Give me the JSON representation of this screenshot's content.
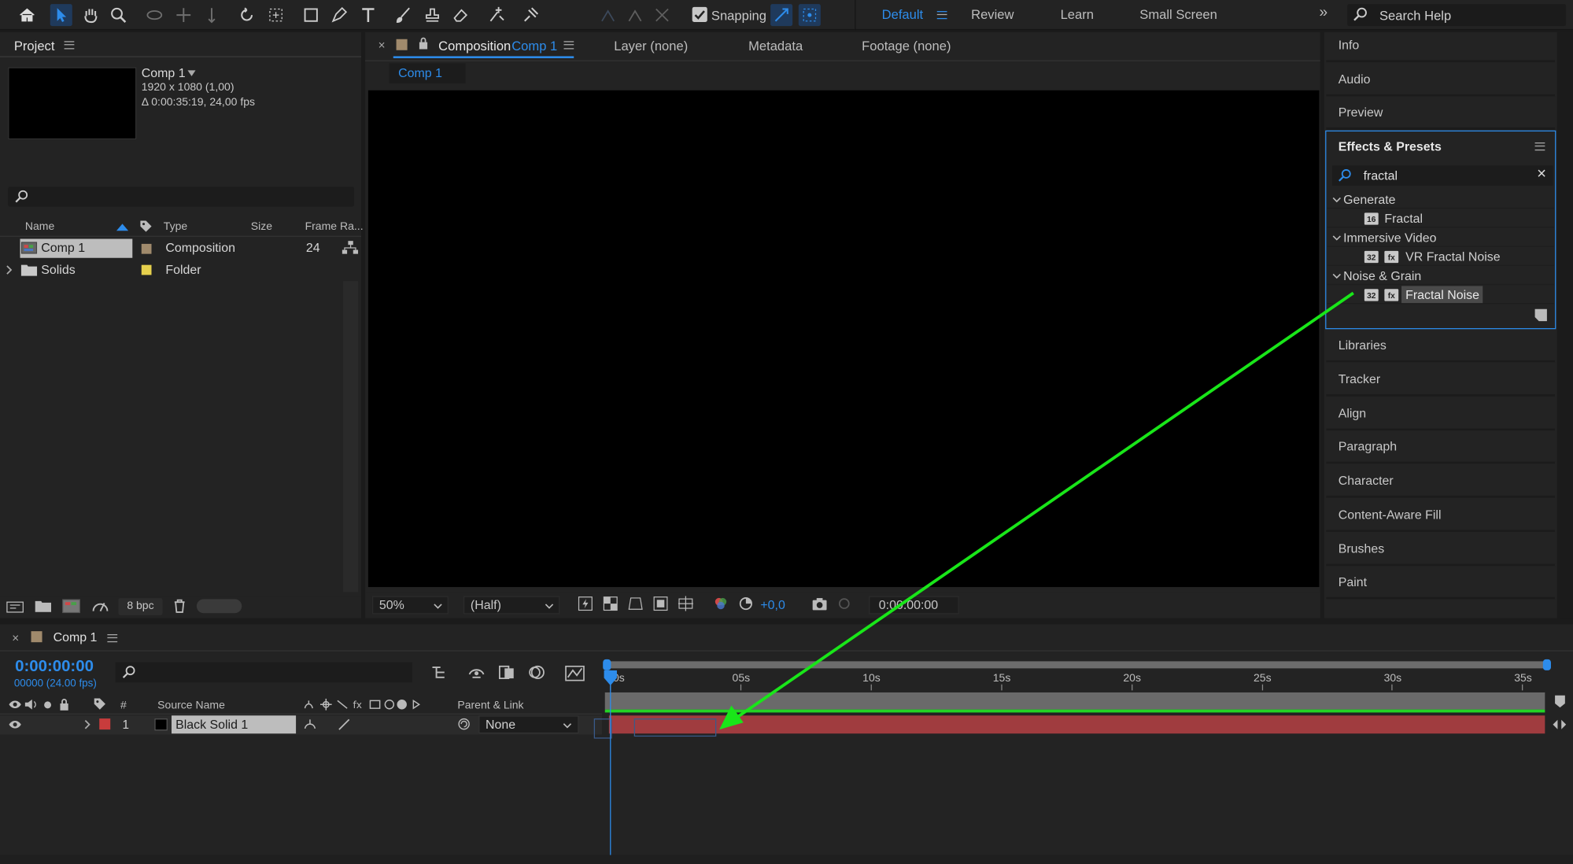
{
  "toolbar": {
    "snapping_label": "Snapping",
    "workspaces": [
      "Default",
      "Review",
      "Learn",
      "Small Screen"
    ],
    "overflow": "»",
    "search_placeholder": "Search Help"
  },
  "project": {
    "panel_title": "Project",
    "comp_name": "Comp 1",
    "comp_res": "1920 x 1080 (1,00)",
    "comp_duration": "Δ 0:00:35:19, 24,00 fps",
    "columns": {
      "name": "Name",
      "type": "Type",
      "size": "Size",
      "framerate": "Frame Ra..."
    },
    "rows": [
      {
        "name": "Comp 1",
        "type": "Composition",
        "framerate": "24",
        "label_color": "#a08a6c"
      },
      {
        "name": "Solids",
        "type": "Folder",
        "framerate": "",
        "label_color": "#e6d04d"
      }
    ],
    "bpc": "8 bpc"
  },
  "viewer": {
    "comp_tab_prefix": "Composition",
    "comp_tab_name": "Comp 1",
    "tabs": [
      "Layer (none)",
      "Metadata",
      "Footage (none)"
    ],
    "breadcrumb": "Comp 1",
    "zoom": "50%",
    "resolution": "(Half)",
    "exposure": "+0,0",
    "timecode": "0:00:00:00"
  },
  "right_panels": {
    "top": [
      "Info",
      "Audio",
      "Preview"
    ],
    "bottom": [
      "Libraries",
      "Tracker",
      "Align",
      "Paragraph",
      "Character",
      "Content-Aware Fill",
      "Brushes",
      "Paint"
    ]
  },
  "effects": {
    "title": "Effects & Presets",
    "search_value": "fractal",
    "categories": [
      {
        "name": "Generate",
        "effect": "Fractal",
        "badges": [
          "16"
        ]
      },
      {
        "name": "Immersive Video",
        "effect": "VR Fractal Noise",
        "badges": [
          "32",
          "fx"
        ]
      },
      {
        "name": "Noise & Grain",
        "effect": "Fractal Noise",
        "badges": [
          "32",
          "fx"
        ]
      }
    ]
  },
  "timeline": {
    "comp_name": "Comp 1",
    "timecode": "0:00:00:00",
    "frames": "00000 (24.00 fps)",
    "columns": {
      "num": "#",
      "source": "Source Name",
      "parent": "Parent & Link"
    },
    "layer": {
      "num": "1",
      "name": "Black Solid 1",
      "parent": "None",
      "label_color": "#c83c3c",
      "bar_color": "#a03c3f"
    },
    "ruler_labels": [
      "0s",
      "05s",
      "10s",
      "15s",
      "20s",
      "25s",
      "30s",
      "35s"
    ]
  },
  "annotation": {
    "arrow_color": "#19e619"
  }
}
